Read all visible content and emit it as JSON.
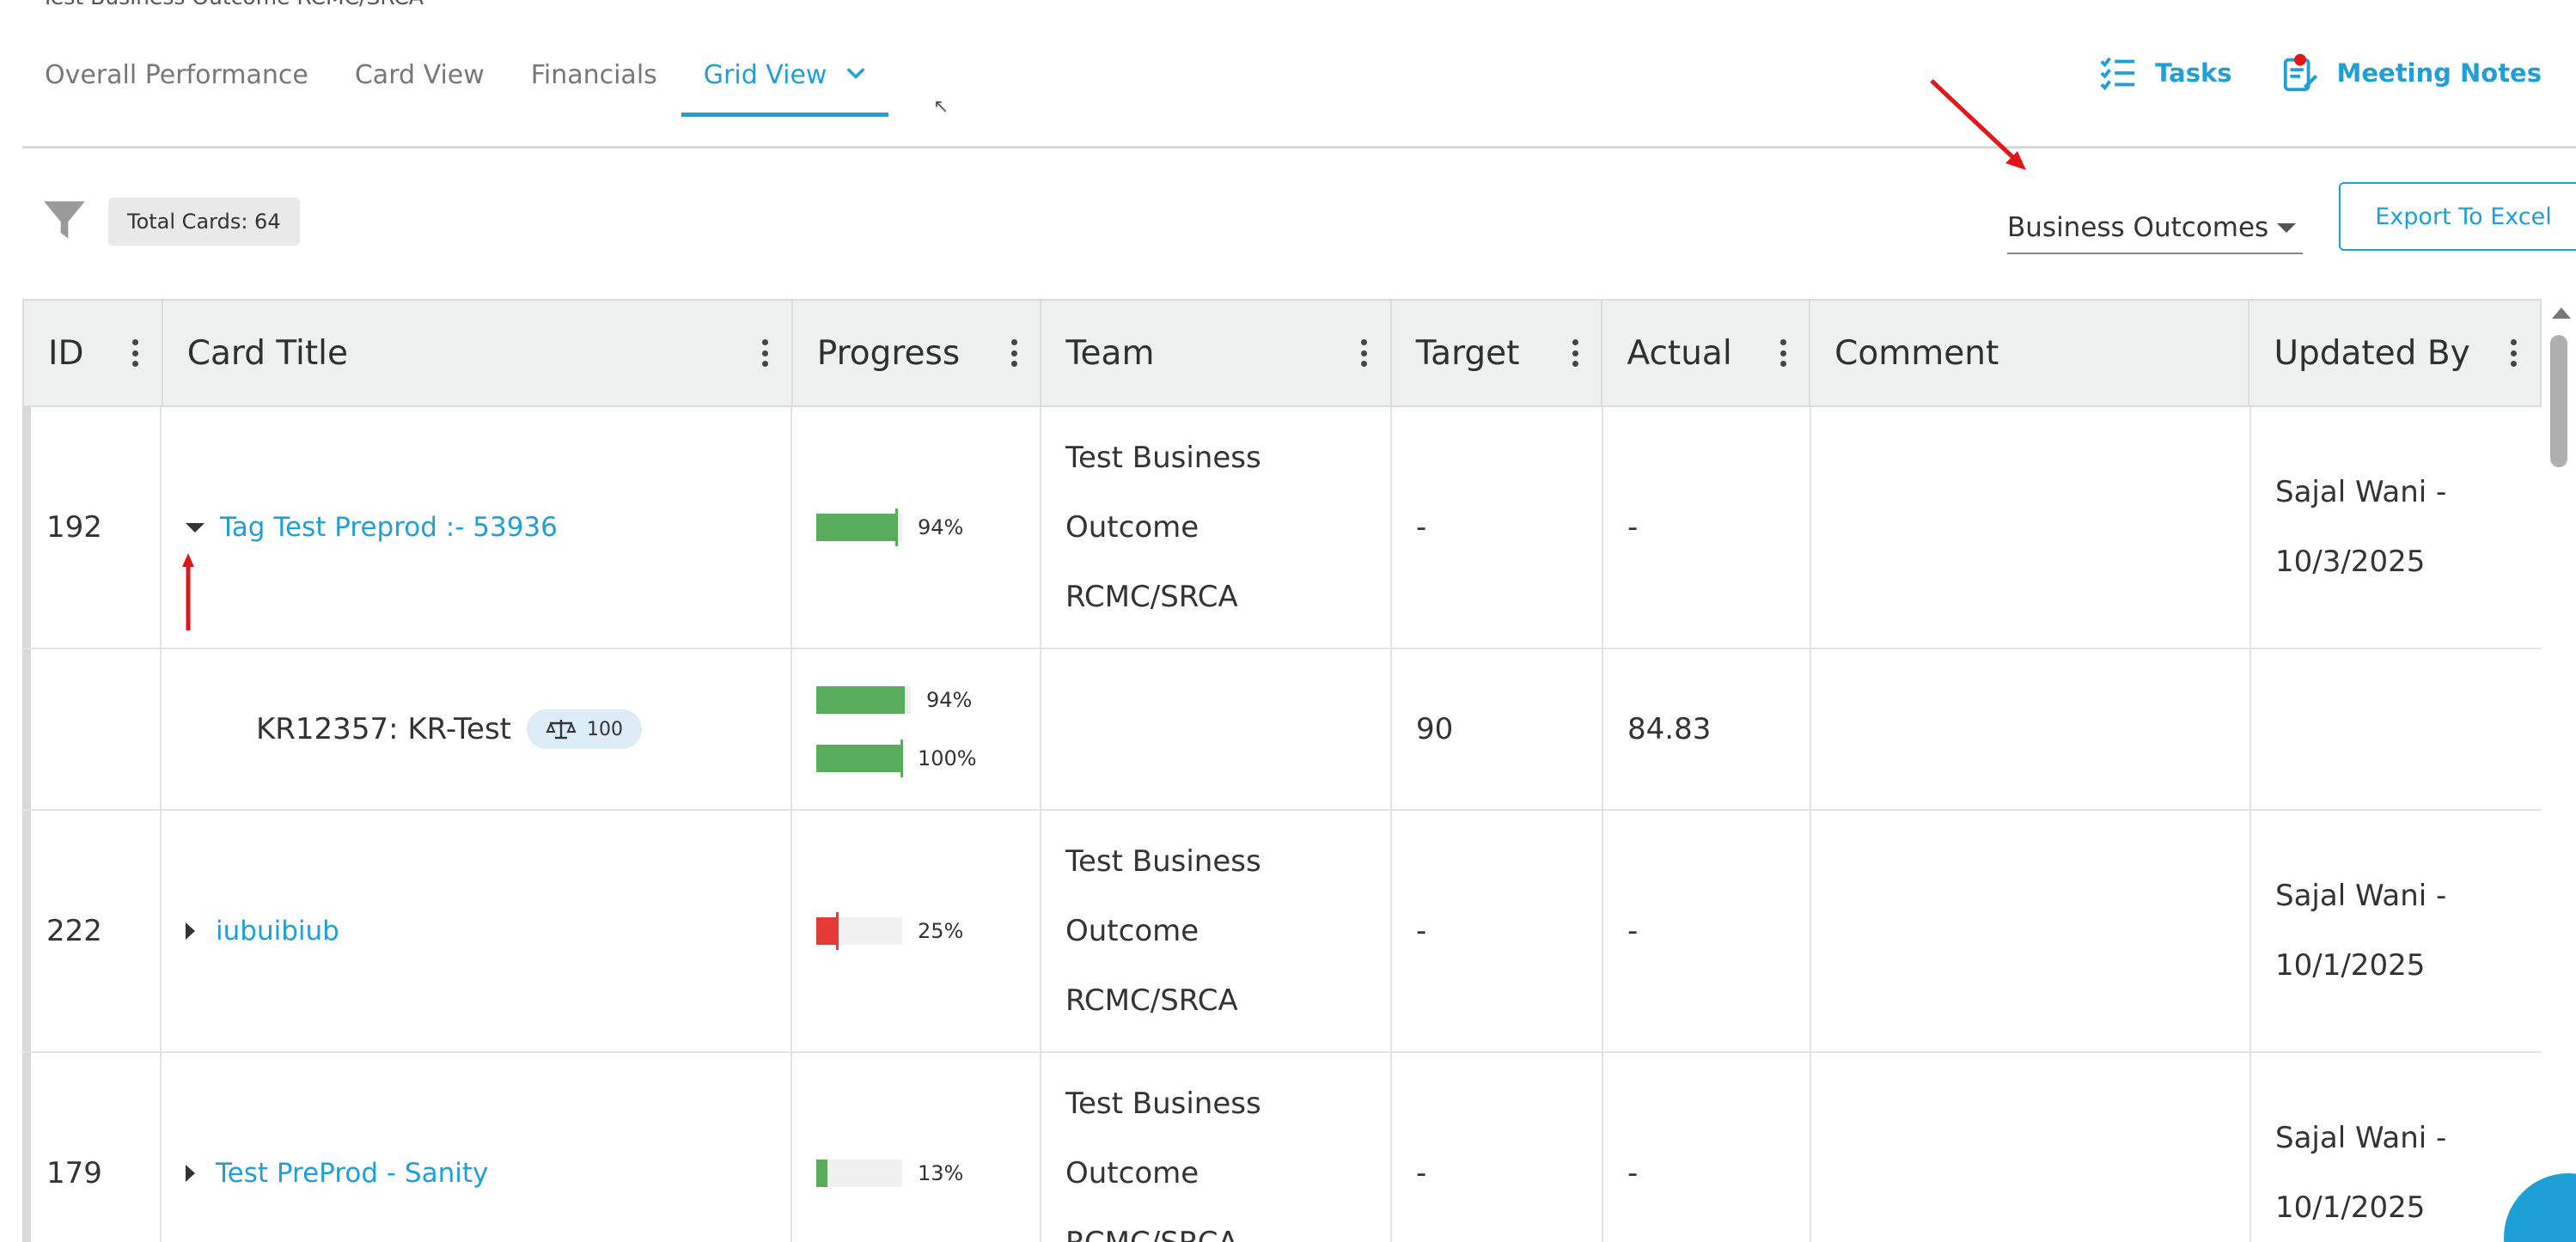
{
  "page": {
    "title": "Test Business Outcome RCMC/SRCA"
  },
  "tabs": [
    {
      "label": "Overall Performance"
    },
    {
      "label": "Card View"
    },
    {
      "label": "Financials"
    },
    {
      "label": "Grid View",
      "active": true
    }
  ],
  "top_actions": {
    "tasks_label": "Tasks",
    "meeting_notes_label": "Meeting Notes"
  },
  "toolbar": {
    "total_cards": "Total Cards: 64",
    "group_by_value": "Business Outcomes",
    "export_label": "Export To Excel"
  },
  "grid": {
    "columns": [
      "ID",
      "Card Title",
      "Progress",
      "Team",
      "Target",
      "Actual",
      "Comment",
      "Updated By"
    ],
    "rows": [
      {
        "id": "192",
        "title": "Tag Test Preprod :- 53936",
        "expanded": true,
        "progress": 0.94,
        "progress_label": "94%",
        "team": [
          "Test Business",
          "Outcome",
          "RCMC/SRCA"
        ],
        "target": "-",
        "actual": "-",
        "comment": "",
        "updated_by": [
          "Sajal Wani -",
          "10/3/2025"
        ],
        "children": [
          {
            "title": "KR12357: KR-Test",
            "weight": "100",
            "progress_1": 0.94,
            "progress_1_label": "94%",
            "progress_2": 1.0,
            "progress_2_label": "100%",
            "target": "90",
            "actual": "84.83"
          }
        ]
      },
      {
        "id": "222",
        "title": "iubuibiub",
        "expanded": false,
        "progress": 0.25,
        "progress_label": "25%",
        "team": [
          "Test Business",
          "Outcome",
          "RCMC/SRCA"
        ],
        "target": "-",
        "actual": "-",
        "comment": "",
        "updated_by": [
          "Sajal Wani -",
          "10/1/2025"
        ]
      },
      {
        "id": "179",
        "title": "Test PreProd - Sanity",
        "expanded": false,
        "progress": 0.13,
        "progress_label": "13%",
        "team": [
          "Test Business",
          "Outcome",
          "RCMC/SRCA"
        ],
        "target": "-",
        "actual": "-",
        "comment": "",
        "updated_by": [
          "Sajal Wani -",
          "10/1/2025"
        ]
      }
    ]
  },
  "colors": {
    "accent": "#1e9fd6",
    "progress_green": "#5aac5d",
    "progress_red": "#e53935",
    "annotation_red": "#e0161b"
  },
  "icons": [
    "filter-icon",
    "tasks-list-icon",
    "meeting-notes-icon",
    "chevron-down-icon",
    "column-menu-icon",
    "scale-icon",
    "help-icon"
  ]
}
